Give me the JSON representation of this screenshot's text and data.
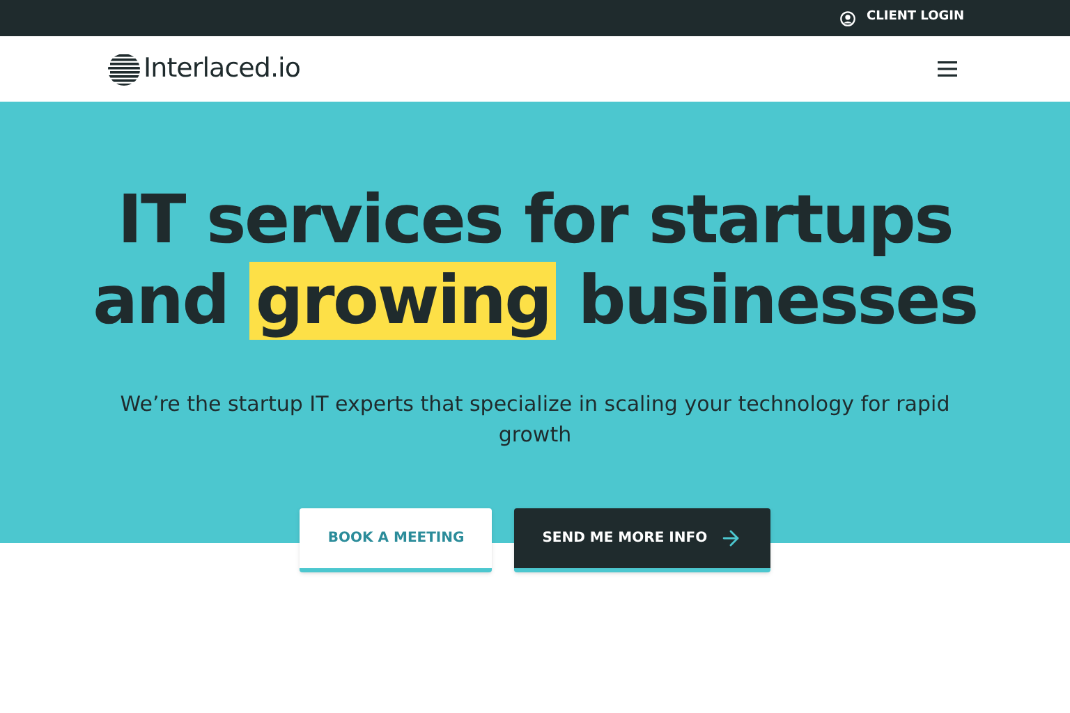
{
  "top_bar": {
    "login": "CLIENT LOGIN"
  },
  "nav": {
    "logo": "Interlaced.io"
  },
  "hero": {
    "title_line_1": "IT services for startups",
    "title_line_2_start": "and",
    "title_highlight": "growing",
    "title_line_2_end": "businesses",
    "subtitle": "We’re the startup IT experts that specialize in scaling your technology for rapid growth",
    "buttons": [
      {
        "label": "BOOK A MEETING",
        "kind": "outline"
      },
      {
        "label": "SEND ME MORE INFO",
        "kind": "dark"
      }
    ]
  }
}
